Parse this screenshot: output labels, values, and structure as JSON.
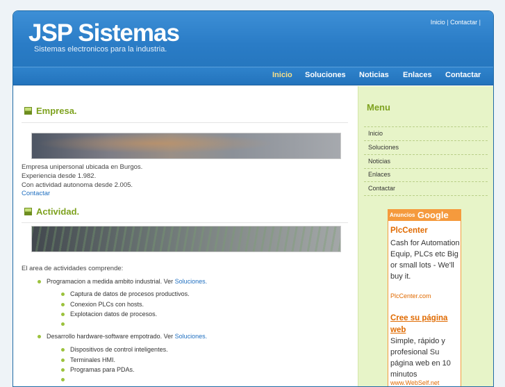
{
  "header": {
    "title": "JSP Sistemas",
    "slogan": "Sistemas electronicos para la industria.",
    "top_links": [
      "Inicio",
      "Contactar"
    ]
  },
  "nav": {
    "items": [
      "Inicio",
      "Soluciones",
      "Noticias",
      "Enlaces",
      "Contactar"
    ],
    "active": "Inicio"
  },
  "main": {
    "empresa": {
      "heading": "Empresa.",
      "lines": [
        "Empresa unipersonal ubicada en Burgos.",
        "Experiencia desde 1.982.",
        "Con actividad autonoma desde 2.005."
      ],
      "link": "Contactar"
    },
    "actividad": {
      "heading": "Actividad.",
      "intro": "El area de actividades comprende:",
      "groups": [
        {
          "text": "Programacion a medida ambito industrial. Ver ",
          "link": "Soluciones.",
          "items": [
            "Captura de datos de procesos productivos.",
            "Conexion PLCs con hosts.",
            "Explotacion datos de procesos.",
            ""
          ]
        },
        {
          "text": "Desarrollo hardware-software empotrado. Ver ",
          "link": "Soluciones.",
          "items": [
            "Dispositivos de control inteligentes.",
            "Terminales HMI.",
            "Programas para PDAs.",
            ""
          ]
        }
      ]
    }
  },
  "sidebar": {
    "menu_title": "Menu",
    "menu_items": [
      "Inicio",
      "Soluciones",
      "Noticias",
      "Enlaces",
      "Contactar"
    ],
    "ads": {
      "label": "Anuncios",
      "brand": "Google",
      "items": [
        {
          "title": "PlcCenter",
          "text": "Cash for Automation Equip, PLCs etc Big or small lots - We'll buy it.",
          "url": "PlcCenter.com"
        },
        {
          "title": "Cree su página web",
          "text": "Simple, rápido y profesional Su página web en 10 minutos",
          "url": "www.WebSelf.net"
        }
      ]
    }
  },
  "colors": {
    "header_blue": "#2a7cc6",
    "accent_green": "#7ea21f",
    "sidebar_bg": "#e7f4c8",
    "ad_orange": "#f59a3d",
    "link_blue": "#1f6fc0"
  }
}
